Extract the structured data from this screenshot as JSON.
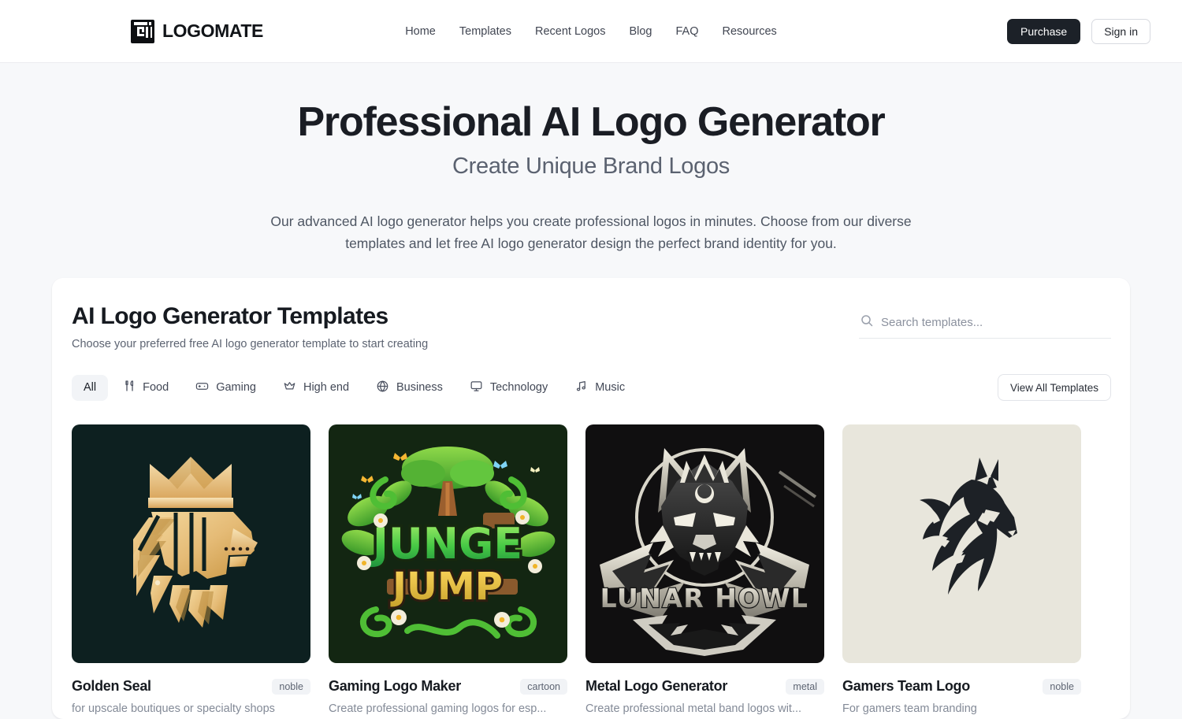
{
  "header": {
    "brand": "LOGOMATE",
    "brand_icon": "logomate-square-mark",
    "nav": [
      {
        "label": "Home"
      },
      {
        "label": "Templates"
      },
      {
        "label": "Recent Logos"
      },
      {
        "label": "Blog"
      },
      {
        "label": "FAQ"
      },
      {
        "label": "Resources"
      }
    ],
    "purchase_label": "Purchase",
    "signin_label": "Sign in"
  },
  "hero": {
    "title": "Professional AI Logo Generator",
    "subtitle": "Create Unique Brand Logos",
    "description": "Our advanced AI logo generator helps you create professional logos in minutes. Choose from our diverse templates and let free AI logo generator design the perfect brand identity for you."
  },
  "panel": {
    "title": "AI Logo Generator Templates",
    "subtitle": "Choose your preferred free AI logo generator template to start creating",
    "search": {
      "placeholder": "Search templates...",
      "value": "",
      "icon": "search-icon"
    },
    "view_all_label": "View All Templates",
    "filters": [
      {
        "label": "All",
        "icon": "none",
        "active": true
      },
      {
        "label": "Food",
        "icon": "fork-knife-icon",
        "active": false
      },
      {
        "label": "Gaming",
        "icon": "gamepad-icon",
        "active": false
      },
      {
        "label": "High end",
        "icon": "crown-icon",
        "active": false
      },
      {
        "label": "Business",
        "icon": "globe-icon",
        "active": false
      },
      {
        "label": "Technology",
        "icon": "monitor-icon",
        "active": false
      },
      {
        "label": "Music",
        "icon": "music-note-icon",
        "active": false
      }
    ],
    "cards": [
      {
        "title": "Golden Seal",
        "badge": "noble",
        "description": "for upscale boutiques or specialty shops",
        "thumbnail": "golden-crowned-lion-head",
        "bg": "#0d2020",
        "accent": "#e8bf7d"
      },
      {
        "title": "Gaming Logo Maker",
        "badge": "cartoon",
        "description": "Create professional gaming logos for esp...",
        "thumbnail": "jungle-game-wordmark-junge-jump",
        "bg": "#132612",
        "accent": "#55c437",
        "art_text_top": "JUNGE",
        "art_text_bottom": "JUMP"
      },
      {
        "title": "Metal Logo Generator",
        "badge": "metal",
        "description": "Create professional metal band logos wit...",
        "thumbnail": "metal-wolf-head-lunar-howl",
        "bg": "#100f10",
        "accent": "#e8e6de",
        "art_text": "LUNAR HOWL"
      },
      {
        "title": "Gamers Team Logo",
        "badge": "noble",
        "description": "For gamers team branding",
        "thumbnail": "black-horse-head-silhouette",
        "bg": "#e8e6dc",
        "accent": "#1d2126"
      }
    ]
  }
}
